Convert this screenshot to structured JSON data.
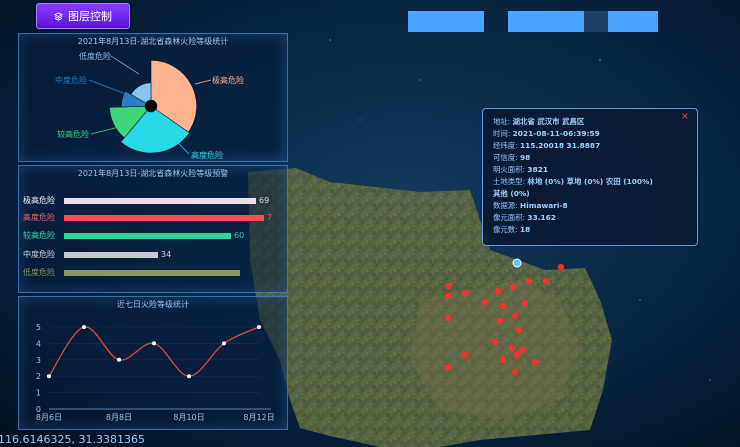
{
  "toolbar": {
    "layer_control_label": "图层控制"
  },
  "pie_panel": {
    "title": "2021年8月13日-湖北省森林火险等级统计"
  },
  "bar_panel": {
    "title": "2021年8月13日-湖北省森林火险等级预警"
  },
  "line_panel": {
    "title": "近七日火险等级统计"
  },
  "info": {
    "address": {
      "label": "地址:",
      "value": "湖北省 武汉市 武昌区"
    },
    "time": {
      "label": "时间:",
      "value": "2021-08-11-06:39:59"
    },
    "lonlat": {
      "label": "经纬度:",
      "value": "115.20018 31.8887"
    },
    "confidence": {
      "label": "可信度:",
      "value": "98"
    },
    "fire_area": {
      "label": "明火面积:",
      "value": "3821"
    },
    "land_type": {
      "label": "土地类型:",
      "value": "林地 (0%) 草地 (0%) 农田 (100%)"
    },
    "land_type_cont": "其他 (0%)",
    "source": {
      "label": "数据源:",
      "value": "Himawari-8"
    },
    "pixel_area": {
      "label": "像元面积:",
      "value": "33.162"
    },
    "pixel_count": {
      "label": "像元数:",
      "value": "18"
    }
  },
  "status": {
    "coordinates": "116.6146325, 31.3381365"
  },
  "colors": {
    "extreme": "#ffb38f",
    "very_high": "#2ad9e8",
    "high": "#3ed47a",
    "medium": "#2a7fc8",
    "low": "#87c4ee",
    "bar_extreme": "#f3dbe8",
    "bar_very_high": "#ff4a5a",
    "bar_high": "#2fd495",
    "bar_medium": "#c9c9c9",
    "bar_low": "#8a9a5a",
    "line": "#e04a3a",
    "fire_point": "#ff2a2a",
    "accent": "#4aa3ff"
  },
  "chart_data": [
    {
      "type": "pie",
      "variant": "rose",
      "title": "2021年8月13日-湖北省森林火险等级统计",
      "slices": [
        {
          "name": "极高危险",
          "value": 69
        },
        {
          "name": "高度危险",
          "value": 72
        },
        {
          "name": "较高危险",
          "value": 60
        },
        {
          "name": "中度危险",
          "value": 34
        },
        {
          "name": "低度危险",
          "value": 20
        }
      ]
    },
    {
      "type": "bar",
      "orientation": "horizontal",
      "title": "2021年8月13日-湖北省森林火险等级预警",
      "categories": [
        "极高危险",
        "高度危险",
        "较高危险",
        "中度危险",
        "低度危险"
      ],
      "values": [
        69,
        72,
        60,
        34,
        null
      ],
      "value_labels": [
        "69",
        "7",
        "60",
        "34",
        ""
      ],
      "xlim": [
        0,
        72
      ]
    },
    {
      "type": "line",
      "title": "近七日火险等级统计",
      "x": [
        "8月6日",
        "8月7日",
        "8月8日",
        "8月9日",
        "8月10日",
        "8月11日",
        "8月12日"
      ],
      "x_tick_labels": [
        "8月6日",
        "8月8日",
        "8月10日",
        "8月12日"
      ],
      "values": [
        2,
        5,
        3,
        4,
        2,
        4,
        5
      ],
      "ylim": [
        0,
        5
      ],
      "yticks": [
        "0",
        "1",
        "2",
        "3",
        "4",
        "5"
      ]
    }
  ]
}
